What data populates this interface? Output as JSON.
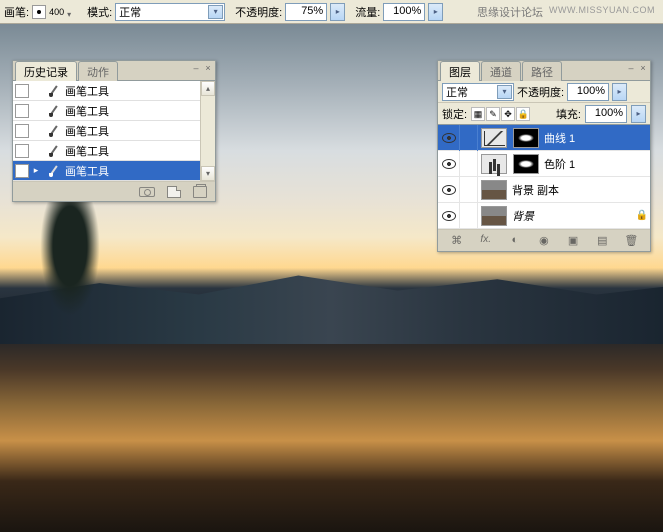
{
  "toolbar": {
    "brush_label": "画笔:",
    "brush_size": "400",
    "mode_label": "模式:",
    "mode_value": "正常",
    "opacity_label": "不透明度:",
    "opacity_value": "75%",
    "flow_label": "流量:",
    "flow_value": "100%"
  },
  "watermark": {
    "text1": "思缘设计论坛",
    "text2": "WWW.MISSYUAN.COM"
  },
  "history_panel": {
    "tab_history": "历史记录",
    "tab_actions": "动作",
    "items": [
      {
        "label": "画笔工具"
      },
      {
        "label": "画笔工具"
      },
      {
        "label": "画笔工具"
      },
      {
        "label": "画笔工具"
      },
      {
        "label": "画笔工具"
      }
    ]
  },
  "layers_panel": {
    "tab_layers": "图层",
    "tab_channels": "通道",
    "tab_paths": "路径",
    "blend_mode": "正常",
    "opacity_label": "不透明度:",
    "opacity_value": "100%",
    "lock_label": "锁定:",
    "fill_label": "填充:",
    "fill_value": "100%",
    "layers": [
      {
        "name": "曲线 1",
        "type": "curves"
      },
      {
        "name": "色阶 1",
        "type": "levels"
      },
      {
        "name": "背景 副本",
        "type": "image"
      },
      {
        "name": "背景",
        "type": "image",
        "locked": true,
        "italic": true
      }
    ],
    "fx_label": "fx."
  }
}
